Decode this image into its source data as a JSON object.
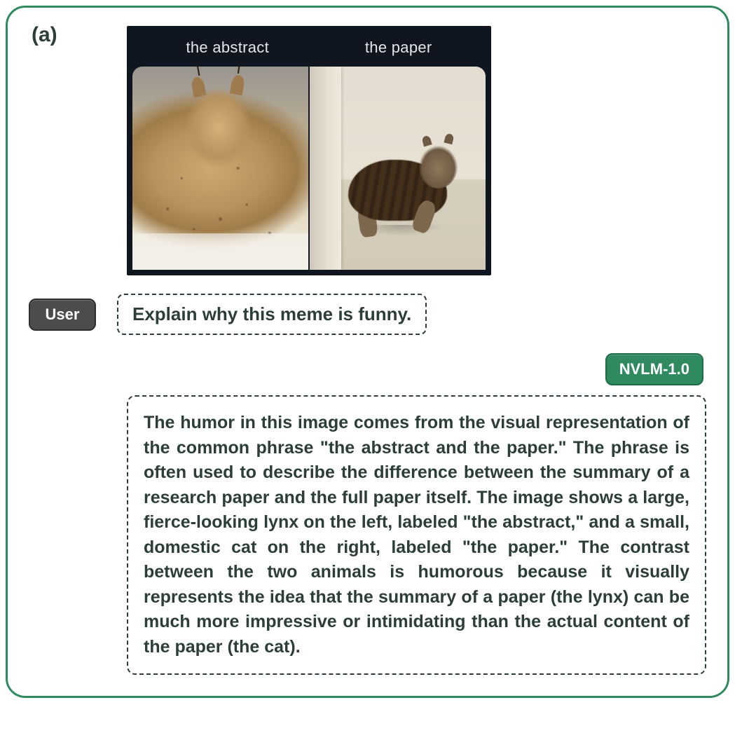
{
  "panel_tag": "(a)",
  "meme": {
    "left_label": "the abstract",
    "right_label": "the paper"
  },
  "user": {
    "badge": "User",
    "prompt": "Explain why this meme is funny."
  },
  "model": {
    "badge": "NVLM-1.0",
    "response": "The humor in this image comes from the visual representation of the common phrase \"the abstract and the paper.\" The phrase is often used to describe the difference between the summary of a research paper and the full paper itself. The image shows a large, fierce-looking lynx on the left, labeled \"the abstract,\" and a small, domestic cat on the right, labeled \"the paper.\" The contrast between the two animals is humorous because it visually represents the idea that the summary of a paper (the lynx) can be much more impressive or intimidating than the actual content of the paper (the cat)."
  }
}
